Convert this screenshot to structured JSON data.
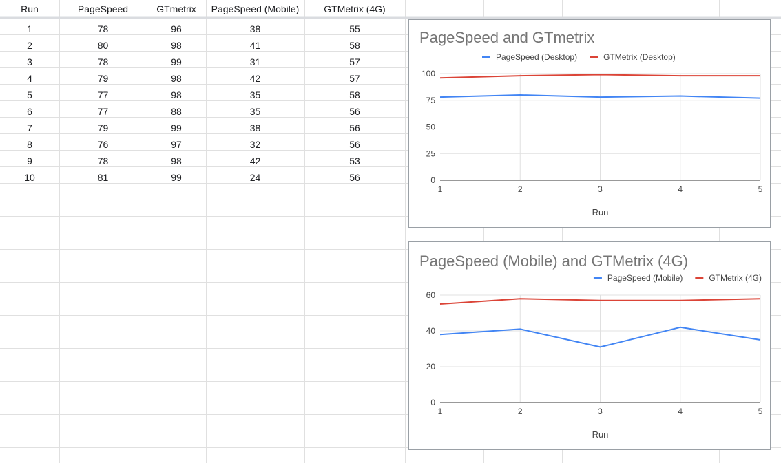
{
  "table": {
    "headers": [
      "Run",
      "PageSpeed",
      "GTmetrix",
      "PageSpeed (Mobile)",
      "GTMetrix (4G)"
    ],
    "rows": [
      [
        "1",
        "78",
        "96",
        "38",
        "55"
      ],
      [
        "2",
        "80",
        "98",
        "41",
        "58"
      ],
      [
        "3",
        "78",
        "99",
        "31",
        "57"
      ],
      [
        "4",
        "79",
        "98",
        "42",
        "57"
      ],
      [
        "5",
        "77",
        "98",
        "35",
        "58"
      ],
      [
        "6",
        "77",
        "88",
        "35",
        "56"
      ],
      [
        "7",
        "79",
        "99",
        "38",
        "56"
      ],
      [
        "8",
        "76",
        "97",
        "32",
        "56"
      ],
      [
        "9",
        "78",
        "98",
        "42",
        "53"
      ],
      [
        "10",
        "81",
        "99",
        "24",
        "56"
      ]
    ]
  },
  "colors": {
    "blue_series": "#4285f4",
    "red_series": "#db4437",
    "gridline": "#e0e0e0",
    "frozen_row_border": "#dadce0"
  },
  "chart_data": [
    {
      "type": "line",
      "title": "PageSpeed and GTmetrix",
      "xlabel": "Run",
      "ylabel": "",
      "x": [
        1,
        2,
        3,
        4,
        5
      ],
      "xticks": [
        "1",
        "2",
        "3",
        "4",
        "5"
      ],
      "ylim": [
        0,
        100
      ],
      "yticks": [
        "0",
        "25",
        "50",
        "75",
        "100"
      ],
      "grid": true,
      "legend": "top",
      "series": [
        {
          "name": "PageSpeed (Desktop)",
          "color": "#4285f4",
          "values": [
            78,
            80,
            78,
            79,
            77
          ]
        },
        {
          "name": "GTMetrix (Desktop)",
          "color": "#db4437",
          "values": [
            96,
            98,
            99,
            98,
            98
          ]
        }
      ]
    },
    {
      "type": "line",
      "title": "PageSpeed (Mobile) and GTMetrix (4G)",
      "xlabel": "Run",
      "ylabel": "",
      "x": [
        1,
        2,
        3,
        4,
        5
      ],
      "xticks": [
        "1",
        "2",
        "3",
        "4",
        "5"
      ],
      "ylim": [
        0,
        60
      ],
      "yticks": [
        "0",
        "20",
        "40",
        "60"
      ],
      "grid": true,
      "legend": "top-right",
      "series": [
        {
          "name": "PageSpeed (Mobile)",
          "color": "#4285f4",
          "values": [
            38,
            41,
            31,
            42,
            35
          ]
        },
        {
          "name": "GTMetrix (4G)",
          "color": "#db4437",
          "values": [
            55,
            58,
            57,
            57,
            58
          ]
        }
      ]
    }
  ]
}
